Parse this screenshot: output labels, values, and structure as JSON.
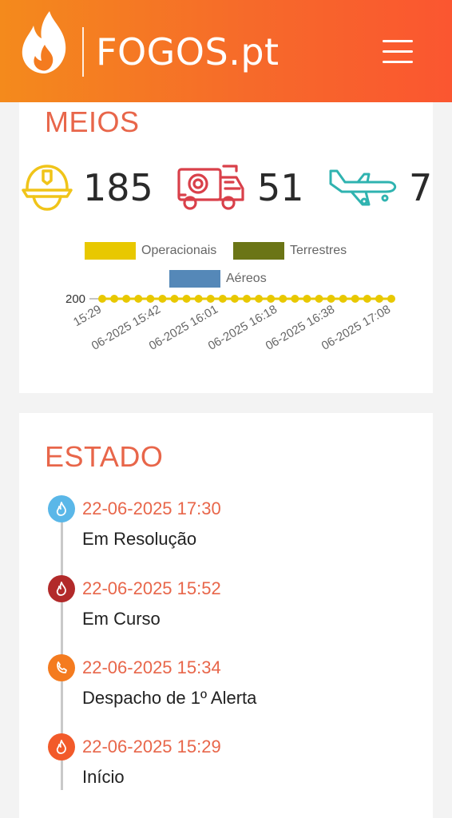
{
  "header": {
    "logo_text": "FOGOS.pt",
    "menu_icon": "hamburger-menu-icon"
  },
  "meios": {
    "title": "MEIOS",
    "stats": [
      {
        "icon": "firefighter-helmet-icon",
        "value": "185",
        "color": "#f0c419"
      },
      {
        "icon": "fire-truck-icon",
        "value": "51",
        "color": "#d9404a"
      },
      {
        "icon": "airplane-icon",
        "value": "7",
        "color": "#2fb3b0"
      }
    ]
  },
  "chart_data": {
    "type": "line",
    "title": "",
    "legend": [
      {
        "name": "Operacionais",
        "color": "#e8c800"
      },
      {
        "name": "Terrestres",
        "color": "#6b7516"
      },
      {
        "name": "Aéreos",
        "color": "#5588b8"
      }
    ],
    "legend_position": "top",
    "y_tick_labels": [
      "200"
    ],
    "x_tick_labels": [
      "15:29",
      "06-2025 15:42",
      "06-2025 16:01",
      "06-2025 16:18",
      "06-2025 16:38",
      "06-2025 17:08"
    ],
    "series": [
      {
        "name": "Operacionais",
        "color": "#e8c800",
        "points": 25,
        "y": 200
      }
    ]
  },
  "estado": {
    "title": "ESTADO",
    "items": [
      {
        "date": "22-06-2025 17:30",
        "status": "Em Resolução",
        "icon": "flame-icon",
        "color": "#5ab7e8"
      },
      {
        "date": "22-06-2025 15:52",
        "status": "Em Curso",
        "icon": "flame-icon",
        "color": "#b22a2a"
      },
      {
        "date": "22-06-2025 15:34",
        "status": "Despacho de 1º Alerta",
        "icon": "phone-alert-icon",
        "color": "#f47b1f"
      },
      {
        "date": "22-06-2025 15:29",
        "status": "Início",
        "icon": "flame-icon",
        "color": "#f25a2a"
      }
    ]
  }
}
